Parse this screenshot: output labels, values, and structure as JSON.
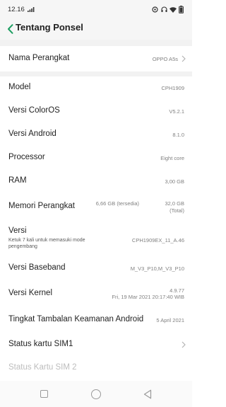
{
  "status_bar": {
    "time": "12.16",
    "signal_icon": "signal-icon",
    "right_icons": [
      "data-saver-icon",
      "headset-icon",
      "wifi-icon",
      "battery-icon"
    ]
  },
  "header": {
    "back_icon": "chevron-left-icon",
    "title": "Tentang Ponsel",
    "accent_color": "#1e9e62"
  },
  "rows": {
    "device_name": {
      "label": "Nama Perangkat",
      "value": "OPPO A5s"
    },
    "model": {
      "label": "Model",
      "value": "CPH1909"
    },
    "coloros": {
      "label": "Versi ColorOS",
      "value": "V5.2.1"
    },
    "android": {
      "label": "Versi Android",
      "value": "8.1.0"
    },
    "processor": {
      "label": "Processor",
      "value": "Eight core"
    },
    "ram": {
      "label": "RAM",
      "value": "3,00 GB"
    },
    "storage": {
      "label": "Memori Perangkat",
      "available": "6,66 GB (tersedia)",
      "total_line1": "32,0 GB",
      "total_line2": "(Total)"
    },
    "version": {
      "label": "Versi",
      "sub": "Ketuk 7 kali untuk memasuki mode pengembang",
      "value": "CPH1909EX_11_A.46"
    },
    "baseband": {
      "label": "Versi Baseband",
      "value": "M_V3_P10,M_V3_P10"
    },
    "kernel": {
      "label": "Versi Kernel",
      "value_line1": "4.9.77",
      "value_line2": "Fri, 19 Mar 2021 20:17:40 WIB"
    },
    "patch": {
      "label": "Tingkat Tambalan Keamanan Android",
      "value": "5 April 2021"
    },
    "sim1": {
      "label": "Status kartu SIM1"
    },
    "sim2": {
      "label": "Status Kartu SIM 2"
    }
  },
  "nav": {
    "recents_icon": "square-icon",
    "home_icon": "circle-icon",
    "back_icon": "triangle-back-icon"
  }
}
